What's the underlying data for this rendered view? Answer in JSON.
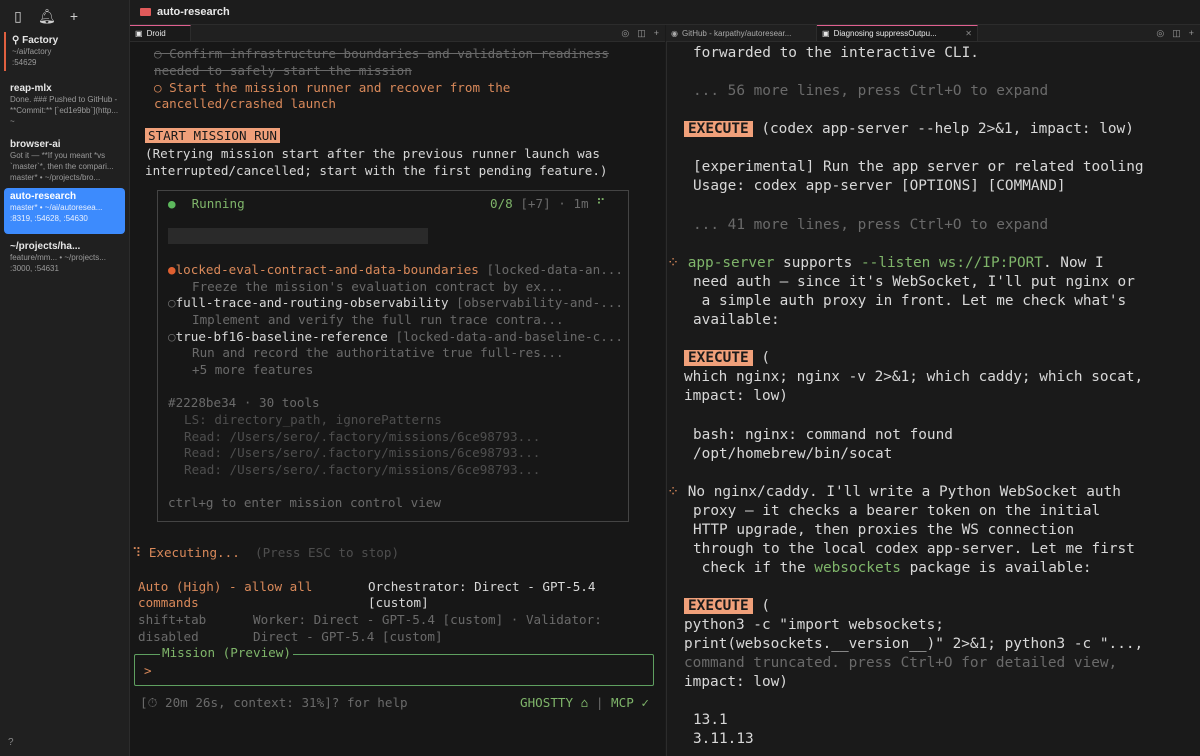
{
  "sidebar": {
    "items": [
      {
        "title": "Factory",
        "lines": [
          "~/ai/factory",
          ":54629"
        ]
      },
      {
        "title": "reap-mlx",
        "lines": [
          "Done. ### Pushed to GitHub -",
          "**Commit:** [`ed1e9bb`](http...",
          "~"
        ]
      },
      {
        "title": "browser-ai",
        "lines": [
          "Got it — **If you meant *vs",
          "`master`*, then the compari...",
          "master* • ~/projects/bro..."
        ]
      },
      {
        "title": "auto-research",
        "lines": [
          "master* • ~/ai/autoresea...",
          ":8319, :54628, :54630"
        ]
      },
      {
        "title": "~/projects/ha...",
        "lines": [
          "feature/mm... • ~/projects...",
          ":3000, :54631"
        ]
      }
    ],
    "help_icon": "?"
  },
  "window": {
    "title": "auto-research"
  },
  "left_tabs": [
    {
      "label": "Droid",
      "icon": "terminal-icon"
    }
  ],
  "right_tabs": [
    {
      "label": "GitHub - karpathy/autoresear...",
      "icon": "github-icon"
    },
    {
      "label": "Diagnosing suppressOutpu...",
      "icon": "terminal-icon"
    }
  ],
  "left": {
    "task1": "○ Confirm infrastructure boundaries and validation readiness",
    "task1b": "needed to safely start the mission",
    "task2": "○ Start the mission runner and recover from the",
    "task2b": "cancelled/crashed launch",
    "start_badge": "START MISSION RUN",
    "start_desc1": "(Retrying mission start after the previous runner launch was",
    "start_desc2": "interrupted/cancelled; start with the first pending feature.)",
    "run_status": "Running",
    "run_progress": "0/8",
    "run_extra": "[+7] · 1m",
    "features": [
      {
        "name": "locked-eval-contract-and-data-boundaries",
        "tag": " [locked-data-an...",
        "desc": "Freeze the mission's evaluation contract by ex..."
      },
      {
        "name": "full-trace-and-routing-observability",
        "tag": " [observability-and-...",
        "desc": "Implement and verify the full run trace contra..."
      },
      {
        "name": "true-bf16-baseline-reference",
        "tag": " [locked-data-and-baseline-c...",
        "desc": "Run and record the authoritative true full-res..."
      }
    ],
    "more_features": "+5 more features",
    "tools_header": "#2228be34 · 30 tools",
    "tool_lines": [
      "LS: directory_path, ignorePatterns",
      "Read: /Users/sero/.factory/missions/6ce98793...",
      "Read: /Users/sero/.factory/missions/6ce98793...",
      "Read: /Users/sero/.factory/missions/6ce98793..."
    ],
    "ctrl_hint": "ctrl+g to enter mission control view",
    "executing": "Executing...",
    "esc_hint": "(Press ESC to stop)",
    "auto_label": "Auto (High) - allow all",
    "auto_label2": "commands",
    "orchestrator": "Orchestrator: Direct - GPT-5.4",
    "orchestrator2": "[custom]",
    "shift_tab": "shift+tab",
    "disabled": "disabled",
    "worker": "Worker: Direct - GPT-5.4 [custom] · Validator:",
    "worker2": "Direct - GPT-5.4 [custom]",
    "input_label": "Mission (Preview)",
    "prompt": ">",
    "status": "[⏱ 20m 26s, context: 31%]? for help",
    "ghostty": "GHOSTTY",
    "mcp": "MCP ✓"
  },
  "right": {
    "l1": "forwarded to the interactive CLI.",
    "more1": "... 56 more lines, press Ctrl+O to expand",
    "exec1": "(codex app-server --help 2>&1, impact: low)",
    "exp1": "[experimental] Run the app server or related tooling",
    "usage": "Usage: codex app-server [OPTIONS] [COMMAND]",
    "more2": "... 41 more lines, press Ctrl+O to expand",
    "msg1_a": "app-server",
    "msg1_b": " supports ",
    "msg1_c": "--listen ws://IP:PORT",
    "msg1_d": ". Now I",
    "msg1_2": "need auth — since it's WebSocket, I'll put nginx or",
    "msg1_3": " a simple auth proxy in front. Let me check what's",
    "msg1_4": "available:",
    "exec_label": "EXECUTE",
    "exec2": "(",
    "exec2_1": "which nginx; nginx -v 2>&1; which caddy; which socat,",
    "exec2_2": "impact: low)",
    "out2_1": "bash: nginx: command not found",
    "out2_2": "/opt/homebrew/bin/socat",
    "msg2_1": "No nginx/caddy. I'll write a Python WebSocket auth",
    "msg2_2": "proxy — it checks a bearer token on the initial",
    "msg2_3": "HTTP upgrade, then proxies the WS connection",
    "msg2_4": "through to the local codex app-server. Let me first",
    "msg2_5a": " check if the ",
    "msg2_5b": "websockets",
    "msg2_5c": " package is available:",
    "exec3": "(",
    "exec3_1": "python3 -c \"import websockets;",
    "exec3_2": "print(websockets.__version__)\" 2>&1; python3 -c \"...,",
    "exec3_3": "command truncated. press Ctrl+O for detailed view,",
    "exec3_4": "impact: low)",
    "out3_1": "13.1",
    "out3_2": "3.11.13"
  }
}
